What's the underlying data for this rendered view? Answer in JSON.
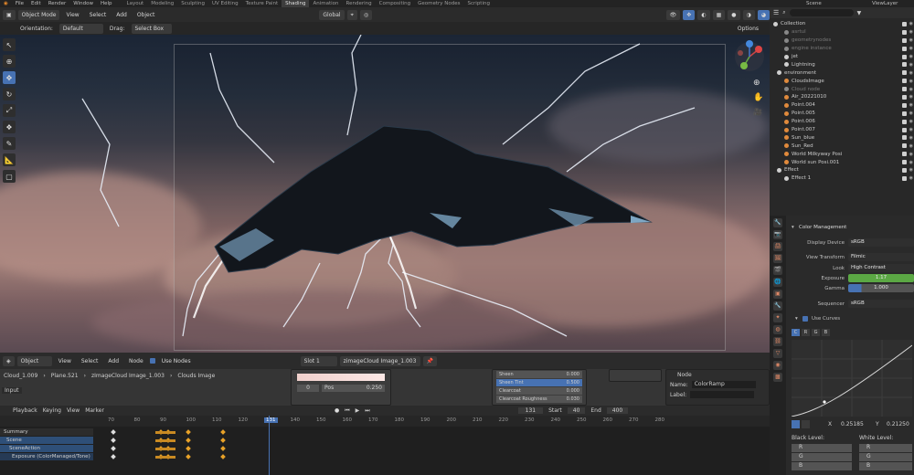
{
  "topbar": {
    "menus": [
      "File",
      "Edit",
      "Render",
      "Window",
      "Help"
    ],
    "workspaces": [
      "Layout",
      "Modeling",
      "Sculpting",
      "UV Editing",
      "Texture Paint",
      "Shading",
      "Animation",
      "Rendering",
      "Compositing",
      "Geometry Nodes",
      "Scripting"
    ],
    "active_workspace": "Shading",
    "scene": "Scene",
    "view_layer": "ViewLayer"
  },
  "viewport_header": {
    "mode": "Object Mode",
    "view": "View",
    "select": "Select",
    "add": "Add",
    "object": "Object",
    "transform": "Global",
    "orientation_label": "Orientation:",
    "orientation_value": "Default",
    "drag_label": "Drag:",
    "drag_value": "Select Box",
    "options": "Options"
  },
  "outliner": {
    "rows": [
      {
        "label": "Collection",
        "hidden": false,
        "icon": "collection-icon",
        "color": "#cfcfcf"
      },
      {
        "label": "asrtul",
        "hidden": true,
        "icon": "object-icon",
        "color": "#888888"
      },
      {
        "label": "geometrynodes",
        "hidden": true,
        "icon": "object-icon",
        "color": "#888888"
      },
      {
        "label": "engine instance",
        "hidden": true,
        "icon": "object-icon",
        "color": "#888888"
      },
      {
        "label": "jet",
        "hidden": false,
        "icon": "object-icon",
        "color": "#cfcfcf"
      },
      {
        "label": "Lightning",
        "hidden": false,
        "icon": "object-icon",
        "color": "#cfcfcf"
      },
      {
        "label": "environment",
        "hidden": false,
        "icon": "collection-icon",
        "color": "#cfcfcf"
      },
      {
        "label": "CloudsImage",
        "hidden": false,
        "icon": "image-icon",
        "color": "#e08a3c"
      },
      {
        "label": "Cloud node",
        "hidden": true,
        "icon": "object-icon",
        "color": "#888888"
      },
      {
        "label": "Air_20221010",
        "hidden": false,
        "icon": "light-icon",
        "color": "#e08a3c"
      },
      {
        "label": "Point.004",
        "hidden": false,
        "icon": "light-icon",
        "color": "#e08a3c"
      },
      {
        "label": "Point.005",
        "hidden": false,
        "icon": "light-icon",
        "color": "#e08a3c"
      },
      {
        "label": "Point.006",
        "hidden": false,
        "icon": "light-icon",
        "color": "#e08a3c"
      },
      {
        "label": "Point.007",
        "hidden": false,
        "icon": "light-icon",
        "color": "#e08a3c"
      },
      {
        "label": "Sun_blue",
        "hidden": false,
        "icon": "light-icon",
        "color": "#e08a3c"
      },
      {
        "label": "Sun_Red",
        "hidden": false,
        "icon": "light-icon",
        "color": "#e08a3c"
      },
      {
        "label": "World Milkyway Posi",
        "hidden": false,
        "icon": "light-icon",
        "color": "#e08a3c"
      },
      {
        "label": "World sun Posi.001",
        "hidden": false,
        "icon": "light-icon",
        "color": "#e08a3c"
      },
      {
        "label": "Effect",
        "hidden": false,
        "icon": "collection-icon",
        "color": "#cfcfcf"
      },
      {
        "label": "Effect 1",
        "hidden": false,
        "icon": "object-icon",
        "color": "#cfcfcf"
      }
    ]
  },
  "properties": {
    "section": "Color Management",
    "display_device_label": "Display Device",
    "display_device": "sRGB",
    "view_transform_label": "View Transform",
    "view_transform": "Filmic",
    "look_label": "Look",
    "look": "High Contrast",
    "exposure_label": "Exposure",
    "exposure": "1.17",
    "gamma_label": "Gamma",
    "gamma": "1.000",
    "sequencer_label": "Sequencer",
    "sequencer": "sRGB",
    "use_curves": "Use Curves",
    "curve_channels": [
      "C",
      "R",
      "G",
      "B"
    ],
    "x_label": "X",
    "x_value": "0.25185",
    "y_label": "Y",
    "y_value": "0.21250",
    "black_level": "Black Level:",
    "white_level": "White Level:",
    "r": "R",
    "g": "G",
    "b": "B"
  },
  "node_editor": {
    "type": "Object",
    "view": "View",
    "select": "Select",
    "add": "Add",
    "node": "Node",
    "use_nodes": "Use Nodes",
    "slot": "Slot 1",
    "material": "zimageCloud Image_1.003",
    "breadcrumb": [
      "Cloud_1.009",
      "Plane.521",
      "zImageCloud Image_1.003",
      "Clouds Image"
    ],
    "input_label": "Input",
    "node_panel_title": "Node",
    "node_name_label": "Name:",
    "node_name": "ColorRamp",
    "node_label_label": "Label:",
    "ramp_pos_label": "Pos",
    "ramp_pos": "0.250",
    "ramp_index": "0",
    "bsdf_rows": [
      {
        "label": "Sheen",
        "value": "0.000"
      },
      {
        "label": "Sheen Tint",
        "value": "0.500"
      },
      {
        "label": "Clearcoat",
        "value": "0.000"
      },
      {
        "label": "Clearcoat Roughness",
        "value": "0.030"
      }
    ]
  },
  "timeline": {
    "playback": "Playback",
    "keying": "Keying",
    "view": "View",
    "marker": "Marker",
    "current_frame": "131",
    "start_label": "Start",
    "start": "40",
    "end_label": "End",
    "end": "400",
    "ticks": [
      "70",
      "80",
      "90",
      "100",
      "110",
      "120",
      "131",
      "140",
      "150",
      "160",
      "170",
      "180",
      "190",
      "200",
      "210",
      "220",
      "230",
      "240",
      "250",
      "260",
      "270",
      "280"
    ],
    "channels": [
      "Summary",
      "Scene",
      "SceneAction",
      "Exposure (ColorManaged/Tone)"
    ]
  },
  "colors": {
    "accent": "#4772b3",
    "exposure_bar": "#5ba844",
    "keyframe": "#e8a228",
    "selected_channel": "#2e4f78"
  }
}
